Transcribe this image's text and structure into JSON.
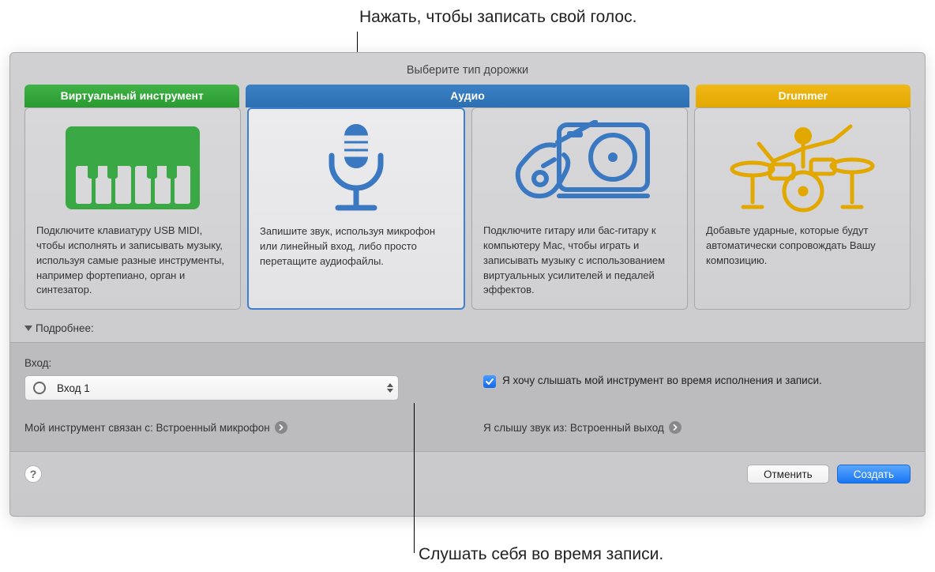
{
  "callouts": {
    "top": "Нажать, чтобы записать свой голос.",
    "bottom": "Слушать себя во время записи."
  },
  "dialog": {
    "title": "Выберите тип дорожки",
    "tabs": {
      "instrument": "Виртуальный инструмент",
      "audio": "Аудио",
      "drummer": "Drummer"
    },
    "cards": {
      "midi": "Подключите клавиатуру USB MIDI, чтобы исполнять и записывать музыку, используя самые разные инструменты, например фортепиано, орган и синтезатор.",
      "mic": "Запишите звук, используя микрофон или линейный вход, либо просто перетащите аудиофайлы.",
      "guitar": "Подключите гитару или бас-гитару к компьютеру Mac, чтобы играть и записывать музыку с использованием виртуальных усилителей и педалей эффектов.",
      "drummer": "Добавьте ударные, которые будут автоматически сопровождать Вашу композицию."
    },
    "details_label": "Подробнее:",
    "input_label": "Вход:",
    "input_value": "Вход 1",
    "monitor_check": "Я хочу слышать мой инструмент во время исполнения и записи.",
    "input_device_prefix": "Мой инструмент связан с: ",
    "input_device": "Встроенный микрофон",
    "output_device_prefix": "Я слышу звук из: ",
    "output_device": "Встроенный выход",
    "cancel": "Отменить",
    "create": "Создать",
    "help": "?"
  }
}
